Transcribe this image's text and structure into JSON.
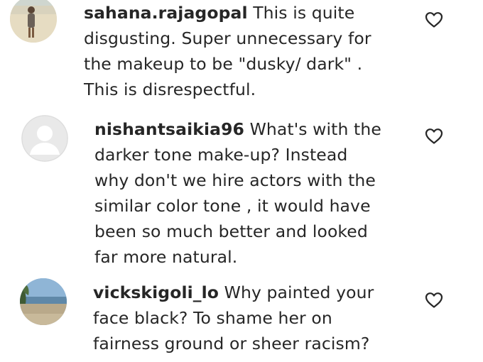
{
  "comments": [
    {
      "username": "sahana.rajagopal",
      "lines": [
        "This is quite",
        "disgusting. Super unnecessary for",
        "the makeup to be \"dusky/ dark\" .",
        "This is disrespectful."
      ],
      "avatar": "beach-photo-avatar",
      "like_icon": "heart-outline-icon"
    },
    {
      "username": "nishantsaikia96",
      "lines": [
        "What's with the",
        "darker tone make-up? Instead",
        "why don't we hire actors with the",
        "similar color tone , it would have",
        "been so much better and looked",
        "far more natural."
      ],
      "avatar": "default-user-avatar",
      "like_icon": "heart-outline-icon"
    },
    {
      "username": "vickskigoli_lo",
      "lines": [
        "Why painted your",
        "face black? To shame her on",
        "fairness ground or sheer racism?"
      ],
      "avatar": "lakeshore-photo-avatar",
      "like_icon": "heart-outline-icon"
    }
  ],
  "colors": {
    "text": "#262626",
    "icon": "#262626",
    "background": "#ffffff"
  }
}
